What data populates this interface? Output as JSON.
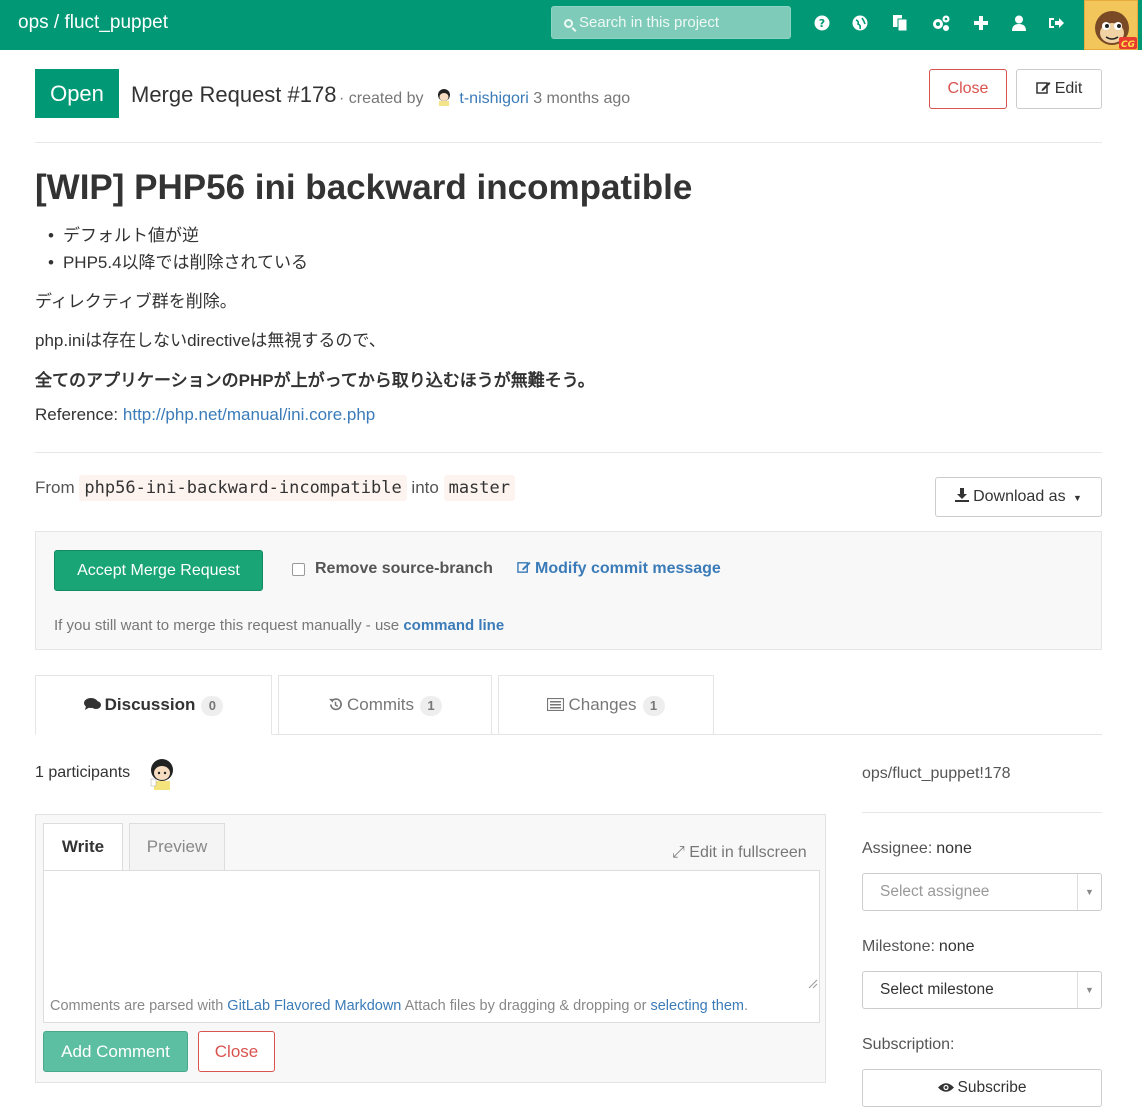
{
  "header": {
    "crumb": "ops / fluct_puppet",
    "search_placeholder": "Search in this project",
    "icons": [
      "help-icon",
      "globe-icon",
      "copy-icon",
      "cogs-icon",
      "plus-icon",
      "user-icon",
      "sign-out-icon"
    ],
    "brand_color": "#019875"
  },
  "mr": {
    "status": "Open",
    "title": "Merge Request #178",
    "created_by": "· created by",
    "author": "t-nishigori",
    "age": "3 months ago",
    "close_label": "Close",
    "edit_label": "Edit"
  },
  "description": {
    "heading": "[WIP] PHP56 ini backward incompatible",
    "bullets": [
      "デフォルト値が逆",
      "PHP5.4以降では削除されている"
    ],
    "p1": "ディレクティブ群を削除。",
    "p2": "php.iniは存在しないdirectiveは無視するので、",
    "p3": "全てのアプリケーションのPHPが上がってから取り込むほうが無難そう。",
    "ref_label": "Reference:",
    "ref_link": "http://php.net/manual/ini.core.php"
  },
  "branch": {
    "from_label": "From",
    "source": "php56-ini-backward-incompatible",
    "into_label": "into",
    "target": "master",
    "download_label": "Download as"
  },
  "merge": {
    "accept_label": "Accept Merge Request",
    "remove_branch_label": "Remove source-branch",
    "modify_label": "Modify commit message",
    "manual_text": "If you still want to merge this request manually - use",
    "command_line": "command line"
  },
  "tabs": [
    {
      "label": "Discussion",
      "count": "0"
    },
    {
      "label": "Commits",
      "count": "1"
    },
    {
      "label": "Changes",
      "count": "1"
    }
  ],
  "discussion": {
    "participants": "1 participants",
    "write_tab": "Write",
    "preview_tab": "Preview",
    "fullscreen": "Edit in fullscreen",
    "hint_prefix": "Comments are parsed with",
    "hint_link": "GitLab Flavored Markdown",
    "hint_mid": "Attach files by dragging & dropping or",
    "hint_link2": "selecting them",
    "hint_end": ".",
    "add_comment": "Add Comment",
    "close": "Close"
  },
  "sidebar": {
    "ref": "ops/fluct_puppet!178",
    "assignee_label": "Assignee:",
    "assignee_value": "none",
    "assignee_placeholder": "Select assignee",
    "milestone_label": "Milestone:",
    "milestone_value": "none",
    "milestone_placeholder": "Select milestone",
    "subscription_label": "Subscription:",
    "subscribe": "Subscribe"
  }
}
